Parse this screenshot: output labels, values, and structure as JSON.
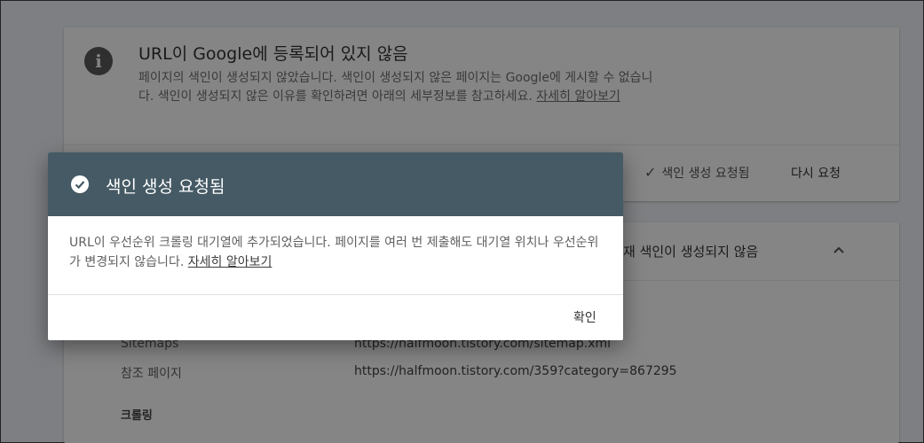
{
  "status_card": {
    "title": "URL이 Google에 등록되어 있지 않음",
    "desc_text": "페이지의 색인이 생성되지 않았습니다. 색인이 생성되지 않은 페이지는 Google에 게시할 수 없습니다. 색인이 생성되지 않은 이유를 확인하려면 아래의 세부정보를 참고하세요. ",
    "learn_more": "자세히 알아보기",
    "requested_label": "색인 생성 요청됨",
    "retry_label": "다시 요청"
  },
  "coverage_card": {
    "header": "재 색인이 생성되지 않음",
    "rows": [
      {
        "label": "Sitemaps",
        "value": "https://halfmoon.tistory.com/sitemap.xml"
      },
      {
        "label": "참조 페이지",
        "value": "https://halfmoon.tistory.com/359?category=867295"
      }
    ],
    "section_label": "크롤링"
  },
  "dialog": {
    "title": "색인 생성 요청됨",
    "body_text": "URL이 우선순위 크롤링 대기열에 추가되었습니다. 페이지를 여러 번 제출해도 대기열 위치나 우선순위가 변경되지 않습니다. ",
    "learn_more": "자세히 알아보기",
    "ok_label": "확인",
    "header_color": "#455a64"
  },
  "icons": {
    "info": "info-icon",
    "check": "check-icon",
    "check_circle": "check-circle-icon",
    "collapse": "chevron-up-icon"
  }
}
